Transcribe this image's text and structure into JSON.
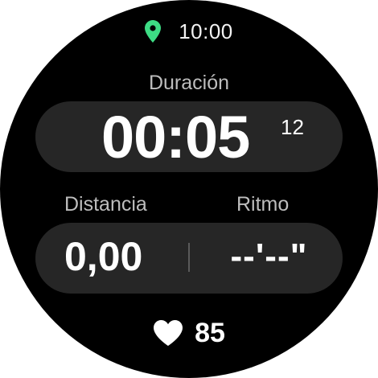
{
  "status_bar": {
    "time": "10:00",
    "location_icon": "location-pin-icon",
    "accent_color": "#3ddc84"
  },
  "duration": {
    "label": "Duración",
    "main": "00:05",
    "sub": "12"
  },
  "distance": {
    "label": "Distancia",
    "value": "0,00"
  },
  "pace": {
    "label": "Ritmo",
    "value": "--'--\""
  },
  "heart_rate": {
    "icon": "heart-icon",
    "value": "85"
  },
  "colors": {
    "background": "#000000",
    "pill": "#262626",
    "label": "#bdbdbd",
    "text": "#ffffff"
  }
}
